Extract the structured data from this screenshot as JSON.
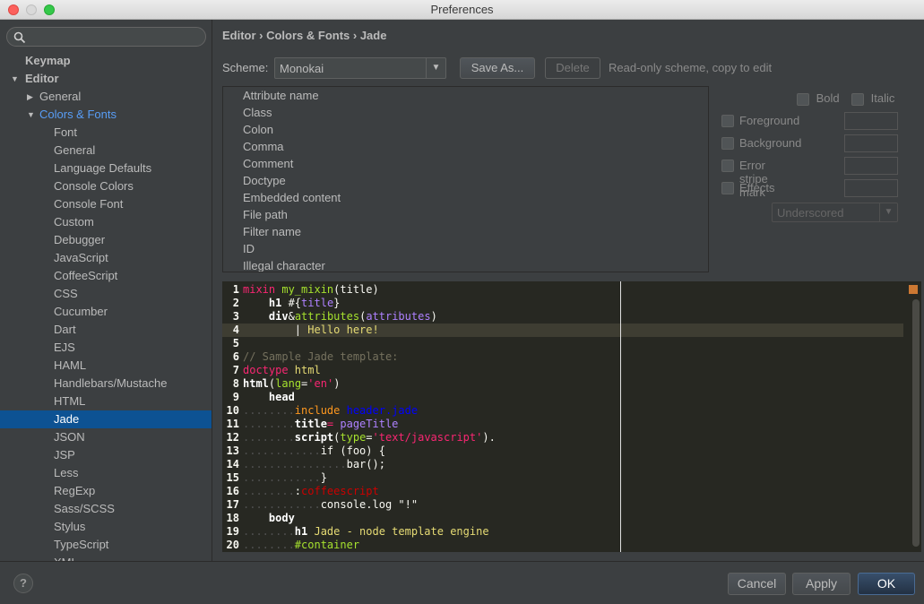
{
  "window": {
    "title": "Preferences"
  },
  "search": {
    "placeholder": ""
  },
  "sidebar": {
    "items": [
      {
        "label": "Keymap",
        "level": 0,
        "bold": true,
        "arrow": ""
      },
      {
        "label": "Editor",
        "level": 0,
        "bold": true,
        "arrow": "▼"
      },
      {
        "label": "General",
        "level": 1,
        "arrow": "▶"
      },
      {
        "label": "Colors & Fonts",
        "level": 1,
        "arrow": "▼",
        "active": true
      },
      {
        "label": "Font",
        "level": 2
      },
      {
        "label": "General",
        "level": 2
      },
      {
        "label": "Language Defaults",
        "level": 2
      },
      {
        "label": "Console Colors",
        "level": 2
      },
      {
        "label": "Console Font",
        "level": 2
      },
      {
        "label": "Custom",
        "level": 2
      },
      {
        "label": "Debugger",
        "level": 2
      },
      {
        "label": "JavaScript",
        "level": 2
      },
      {
        "label": "CoffeeScript",
        "level": 2
      },
      {
        "label": "CSS",
        "level": 2
      },
      {
        "label": "Cucumber",
        "level": 2
      },
      {
        "label": "Dart",
        "level": 2
      },
      {
        "label": "EJS",
        "level": 2
      },
      {
        "label": "HAML",
        "level": 2
      },
      {
        "label": "Handlebars/Mustache",
        "level": 2
      },
      {
        "label": "HTML",
        "level": 2
      },
      {
        "label": "Jade",
        "level": 2,
        "selected": true
      },
      {
        "label": "JSON",
        "level": 2
      },
      {
        "label": "JSP",
        "level": 2
      },
      {
        "label": "Less",
        "level": 2
      },
      {
        "label": "RegExp",
        "level": 2
      },
      {
        "label": "Sass/SCSS",
        "level": 2
      },
      {
        "label": "Stylus",
        "level": 2
      },
      {
        "label": "TypeScript",
        "level": 2
      },
      {
        "label": "XML",
        "level": 2
      }
    ]
  },
  "breadcrumb": "Editor › Colors & Fonts › Jade",
  "scheme": {
    "label": "Scheme:",
    "value": "Monokai",
    "save_as": "Save As...",
    "delete": "Delete",
    "hint": "Read-only scheme, copy to edit"
  },
  "attributes": [
    "Attribute name",
    "Class",
    "Colon",
    "Comma",
    "Comment",
    "Doctype",
    "Embedded content",
    "File path",
    "Filter name",
    "ID",
    "Illegal character"
  ],
  "options": {
    "bold": "Bold",
    "italic": "Italic",
    "foreground": "Foreground",
    "background": "Background",
    "error_stripe": "Error stripe mark",
    "effects": "Effects",
    "effect_type": "Underscored"
  },
  "code": [
    [
      [
        "t-kw",
        "mixin "
      ],
      [
        "t-attr",
        "my_mixin"
      ],
      [
        "t-plain",
        "(title)"
      ]
    ],
    [
      [
        "t-plain",
        "    "
      ],
      [
        "t-tag",
        "h1"
      ],
      [
        "t-plain",
        " #{"
      ],
      [
        "t-cls",
        "title"
      ],
      [
        "t-plain",
        "}"
      ]
    ],
    [
      [
        "t-plain",
        "    "
      ],
      [
        "t-tag",
        "div"
      ],
      [
        "t-plain",
        "&"
      ],
      [
        "t-attr",
        "attributes"
      ],
      [
        "t-plain",
        "("
      ],
      [
        "t-cls",
        "attributes"
      ],
      [
        "t-plain",
        ")"
      ]
    ],
    [
      [
        "t-plain",
        "        | "
      ],
      [
        "t-str",
        "Hello here!"
      ]
    ],
    [],
    [
      [
        "t-cmt",
        "// Sample Jade template:"
      ]
    ],
    [
      [
        "t-kw",
        "doctype"
      ],
      [
        "t-str",
        " html"
      ]
    ],
    [
      [
        "t-tag",
        "html"
      ],
      [
        "t-plain",
        "("
      ],
      [
        "t-attr",
        "lang"
      ],
      [
        "t-plain",
        "="
      ],
      [
        "t-kw",
        "'en'"
      ],
      [
        "t-plain",
        ")"
      ]
    ],
    [
      [
        "t-dots",
        "    "
      ],
      [
        "t-tag",
        "head"
      ]
    ],
    [
      [
        "t-dots",
        "........"
      ],
      [
        "t-inc",
        "include "
      ],
      [
        "t-fl",
        "header.jade"
      ]
    ],
    [
      [
        "t-dots",
        "........"
      ],
      [
        "t-tag",
        "title"
      ],
      [
        "t-kw",
        "= "
      ],
      [
        "t-cls",
        "pageTitle"
      ]
    ],
    [
      [
        "t-dots",
        "........"
      ],
      [
        "t-tag",
        "script"
      ],
      [
        "t-plain",
        "("
      ],
      [
        "t-attr",
        "type"
      ],
      [
        "t-plain",
        "="
      ],
      [
        "t-kw",
        "'text/javascript'"
      ],
      [
        "t-plain",
        ")."
      ]
    ],
    [
      [
        "t-dots",
        "............"
      ],
      [
        "t-plain",
        "if (foo) {"
      ]
    ],
    [
      [
        "t-dots",
        "................"
      ],
      [
        "t-plain",
        "bar();"
      ]
    ],
    [
      [
        "t-dots",
        "............"
      ],
      [
        "t-plain",
        "}"
      ]
    ],
    [
      [
        "t-dots",
        "........"
      ],
      [
        "t-plain",
        ":"
      ],
      [
        "t-red",
        "coffeescript"
      ]
    ],
    [
      [
        "t-dots",
        "............"
      ],
      [
        "t-plain",
        "console.log \"!\""
      ]
    ],
    [
      [
        "t-dots",
        "    "
      ],
      [
        "t-tag",
        "body"
      ]
    ],
    [
      [
        "t-dots",
        "........"
      ],
      [
        "t-tag",
        "h1"
      ],
      [
        "t-str",
        " Jade - node template engine"
      ]
    ],
    [
      [
        "t-dots",
        "........"
      ],
      [
        "t-attr",
        "#container"
      ]
    ]
  ],
  "code_current_line": 4,
  "footer": {
    "help": "?",
    "cancel": "Cancel",
    "apply": "Apply",
    "ok": "OK"
  }
}
